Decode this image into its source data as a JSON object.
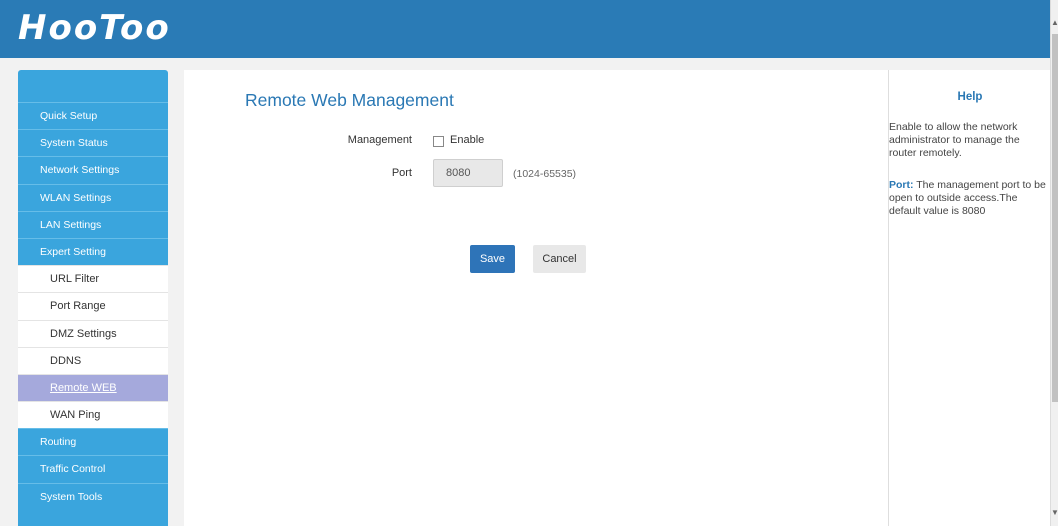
{
  "header": {
    "logo": "HooToo"
  },
  "sidebar": {
    "items": [
      {
        "label": "Quick Setup"
      },
      {
        "label": "System Status"
      },
      {
        "label": "Network Settings"
      },
      {
        "label": "WLAN Settings"
      },
      {
        "label": "LAN Settings"
      },
      {
        "label": "Expert Setting"
      }
    ],
    "subitems": [
      {
        "label": "URL Filter"
      },
      {
        "label": "Port Range"
      },
      {
        "label": "DMZ Settings"
      },
      {
        "label": "DDNS"
      },
      {
        "label": "Remote WEB",
        "active": true
      },
      {
        "label": "WAN Ping"
      }
    ],
    "bottom_items": [
      {
        "label": "Routing"
      },
      {
        "label": "Traffic Control"
      },
      {
        "label": "System Tools"
      }
    ]
  },
  "main": {
    "title": "Remote Web Management",
    "management_label": "Management",
    "enable_label": "Enable",
    "enable_checked": false,
    "port_label": "Port",
    "port_value": "8080",
    "port_hint": "(1024-65535)",
    "save_label": "Save",
    "cancel_label": "Cancel"
  },
  "help": {
    "title": "Help",
    "text": "Enable to allow the network administrator to manage the router remotely.",
    "port_label": "Port:",
    "port_text": " The management port to be open to outside access.The default value is 8080"
  },
  "colors": {
    "header_bg": "#2a7bb6",
    "sidebar_bg": "#3aa5dd",
    "active_item_bg": "#a5a9dc",
    "accent": "#2a78b4",
    "save_button": "#2e74b8"
  }
}
